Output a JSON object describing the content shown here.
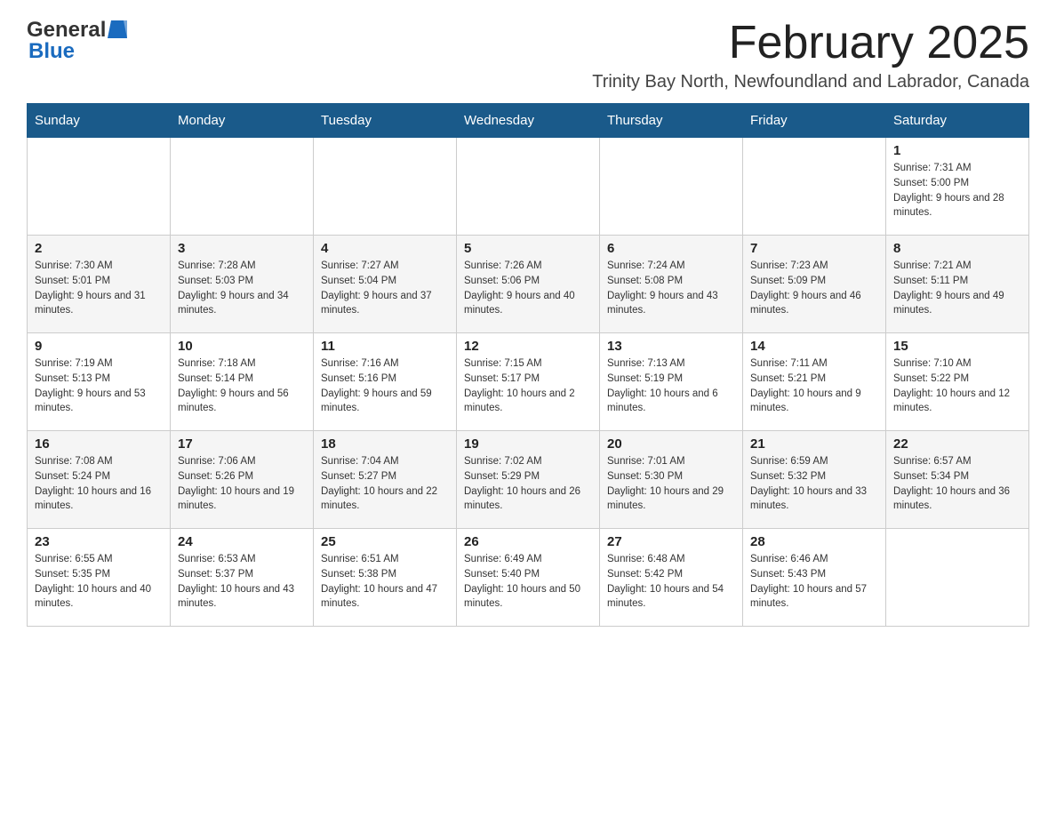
{
  "header": {
    "logo_general": "General",
    "logo_blue": "Blue",
    "main_title": "February 2025",
    "subtitle": "Trinity Bay North, Newfoundland and Labrador, Canada"
  },
  "days_of_week": [
    "Sunday",
    "Monday",
    "Tuesday",
    "Wednesday",
    "Thursday",
    "Friday",
    "Saturday"
  ],
  "weeks": [
    {
      "days": [
        {
          "num": "",
          "info": ""
        },
        {
          "num": "",
          "info": ""
        },
        {
          "num": "",
          "info": ""
        },
        {
          "num": "",
          "info": ""
        },
        {
          "num": "",
          "info": ""
        },
        {
          "num": "",
          "info": ""
        },
        {
          "num": "1",
          "info": "Sunrise: 7:31 AM\nSunset: 5:00 PM\nDaylight: 9 hours and 28 minutes."
        }
      ]
    },
    {
      "days": [
        {
          "num": "2",
          "info": "Sunrise: 7:30 AM\nSunset: 5:01 PM\nDaylight: 9 hours and 31 minutes."
        },
        {
          "num": "3",
          "info": "Sunrise: 7:28 AM\nSunset: 5:03 PM\nDaylight: 9 hours and 34 minutes."
        },
        {
          "num": "4",
          "info": "Sunrise: 7:27 AM\nSunset: 5:04 PM\nDaylight: 9 hours and 37 minutes."
        },
        {
          "num": "5",
          "info": "Sunrise: 7:26 AM\nSunset: 5:06 PM\nDaylight: 9 hours and 40 minutes."
        },
        {
          "num": "6",
          "info": "Sunrise: 7:24 AM\nSunset: 5:08 PM\nDaylight: 9 hours and 43 minutes."
        },
        {
          "num": "7",
          "info": "Sunrise: 7:23 AM\nSunset: 5:09 PM\nDaylight: 9 hours and 46 minutes."
        },
        {
          "num": "8",
          "info": "Sunrise: 7:21 AM\nSunset: 5:11 PM\nDaylight: 9 hours and 49 minutes."
        }
      ]
    },
    {
      "days": [
        {
          "num": "9",
          "info": "Sunrise: 7:19 AM\nSunset: 5:13 PM\nDaylight: 9 hours and 53 minutes."
        },
        {
          "num": "10",
          "info": "Sunrise: 7:18 AM\nSunset: 5:14 PM\nDaylight: 9 hours and 56 minutes."
        },
        {
          "num": "11",
          "info": "Sunrise: 7:16 AM\nSunset: 5:16 PM\nDaylight: 9 hours and 59 minutes."
        },
        {
          "num": "12",
          "info": "Sunrise: 7:15 AM\nSunset: 5:17 PM\nDaylight: 10 hours and 2 minutes."
        },
        {
          "num": "13",
          "info": "Sunrise: 7:13 AM\nSunset: 5:19 PM\nDaylight: 10 hours and 6 minutes."
        },
        {
          "num": "14",
          "info": "Sunrise: 7:11 AM\nSunset: 5:21 PM\nDaylight: 10 hours and 9 minutes."
        },
        {
          "num": "15",
          "info": "Sunrise: 7:10 AM\nSunset: 5:22 PM\nDaylight: 10 hours and 12 minutes."
        }
      ]
    },
    {
      "days": [
        {
          "num": "16",
          "info": "Sunrise: 7:08 AM\nSunset: 5:24 PM\nDaylight: 10 hours and 16 minutes."
        },
        {
          "num": "17",
          "info": "Sunrise: 7:06 AM\nSunset: 5:26 PM\nDaylight: 10 hours and 19 minutes."
        },
        {
          "num": "18",
          "info": "Sunrise: 7:04 AM\nSunset: 5:27 PM\nDaylight: 10 hours and 22 minutes."
        },
        {
          "num": "19",
          "info": "Sunrise: 7:02 AM\nSunset: 5:29 PM\nDaylight: 10 hours and 26 minutes."
        },
        {
          "num": "20",
          "info": "Sunrise: 7:01 AM\nSunset: 5:30 PM\nDaylight: 10 hours and 29 minutes."
        },
        {
          "num": "21",
          "info": "Sunrise: 6:59 AM\nSunset: 5:32 PM\nDaylight: 10 hours and 33 minutes."
        },
        {
          "num": "22",
          "info": "Sunrise: 6:57 AM\nSunset: 5:34 PM\nDaylight: 10 hours and 36 minutes."
        }
      ]
    },
    {
      "days": [
        {
          "num": "23",
          "info": "Sunrise: 6:55 AM\nSunset: 5:35 PM\nDaylight: 10 hours and 40 minutes."
        },
        {
          "num": "24",
          "info": "Sunrise: 6:53 AM\nSunset: 5:37 PM\nDaylight: 10 hours and 43 minutes."
        },
        {
          "num": "25",
          "info": "Sunrise: 6:51 AM\nSunset: 5:38 PM\nDaylight: 10 hours and 47 minutes."
        },
        {
          "num": "26",
          "info": "Sunrise: 6:49 AM\nSunset: 5:40 PM\nDaylight: 10 hours and 50 minutes."
        },
        {
          "num": "27",
          "info": "Sunrise: 6:48 AM\nSunset: 5:42 PM\nDaylight: 10 hours and 54 minutes."
        },
        {
          "num": "28",
          "info": "Sunrise: 6:46 AM\nSunset: 5:43 PM\nDaylight: 10 hours and 57 minutes."
        },
        {
          "num": "",
          "info": ""
        }
      ]
    }
  ]
}
